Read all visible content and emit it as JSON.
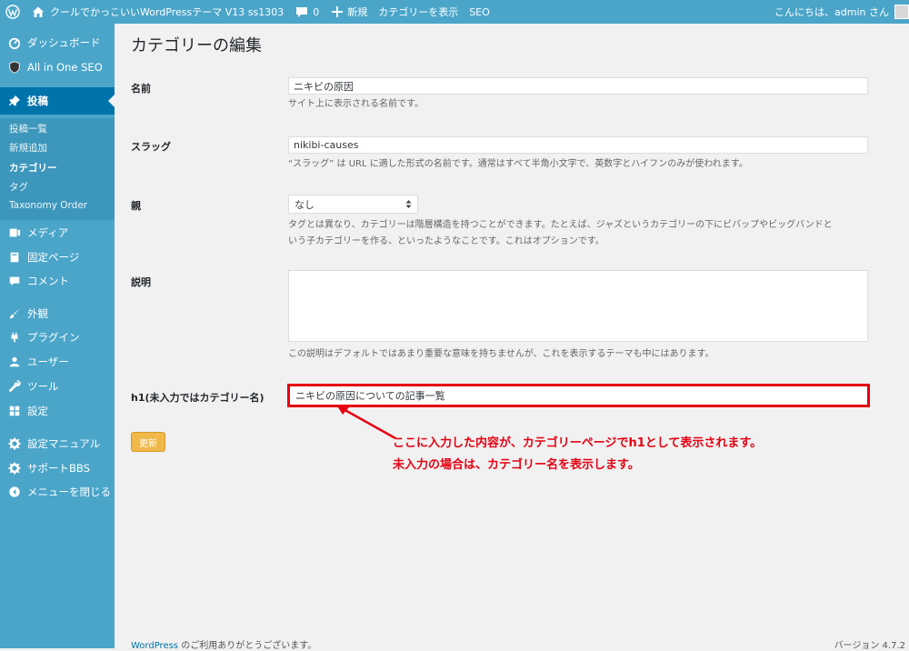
{
  "adminbar": {
    "site_name": "クールでかっこいいWordPressテーマ V13 ss1303",
    "comments_count": "0",
    "new_label": "新規",
    "view_category": "カテゴリーを表示",
    "seo": "SEO",
    "greeting": "こんにちは、admin さん"
  },
  "sidebar": {
    "dashboard": "ダッシュボード",
    "aioseo": "All in One SEO",
    "posts": "投稿",
    "sub": {
      "all_posts": "投稿一覧",
      "add_new": "新規追加",
      "categories": "カテゴリー",
      "tags": "タグ",
      "taxonomy_order": "Taxonomy Order"
    },
    "media": "メディア",
    "pages": "固定ページ",
    "comments": "コメント",
    "appearance": "外観",
    "plugins": "プラグイン",
    "users": "ユーザー",
    "tools": "ツール",
    "settings": "設定",
    "manual": "設定マニュアル",
    "support": "サポートBBS",
    "collapse": "メニューを閉じる"
  },
  "page": {
    "title": "カテゴリーの編集",
    "name_label": "名前",
    "name_value": "ニキビの原因",
    "name_desc": "サイト上に表示される名前です。",
    "slug_label": "スラッグ",
    "slug_value": "nikibi-causes",
    "slug_desc": "“スラッグ” は URL に適した形式の名前です。通常はすべて半角小文字で、英数字とハイフンのみが使われます。",
    "parent_label": "親",
    "parent_value": "なし",
    "parent_desc_1": "タグとは異なり、カテゴリーは階層構造を持つことができます。たとえば、ジャズというカテゴリーの下にビバップやビッグバンドと",
    "parent_desc_2": "いう子カテゴリーを作る、といったようなことです。これはオプションです。",
    "description_label": "説明",
    "description_desc": "この説明はデフォルトではあまり重要な意味を持ちませんが、これを表示するテーマも中にはあります。",
    "h1_label": "h1(未入力ではカテゴリー名)",
    "h1_value": "ニキビの原因についての記事一覧",
    "update_button": "更新",
    "annotation_1": "ここに入力した内容が、カテゴリーページでh1として表示されます。",
    "annotation_2": "未入力の場合は、カテゴリー名を表示します。"
  },
  "footer": {
    "wp_link": "WordPress",
    "thanks": " のご利用ありがとうございます。",
    "version": "バージョン 4.7.2"
  },
  "colors": {
    "sidebar": "#4aa5c9",
    "current": "#0073aa",
    "highlight": "#e60012",
    "button": "#f0b849"
  }
}
